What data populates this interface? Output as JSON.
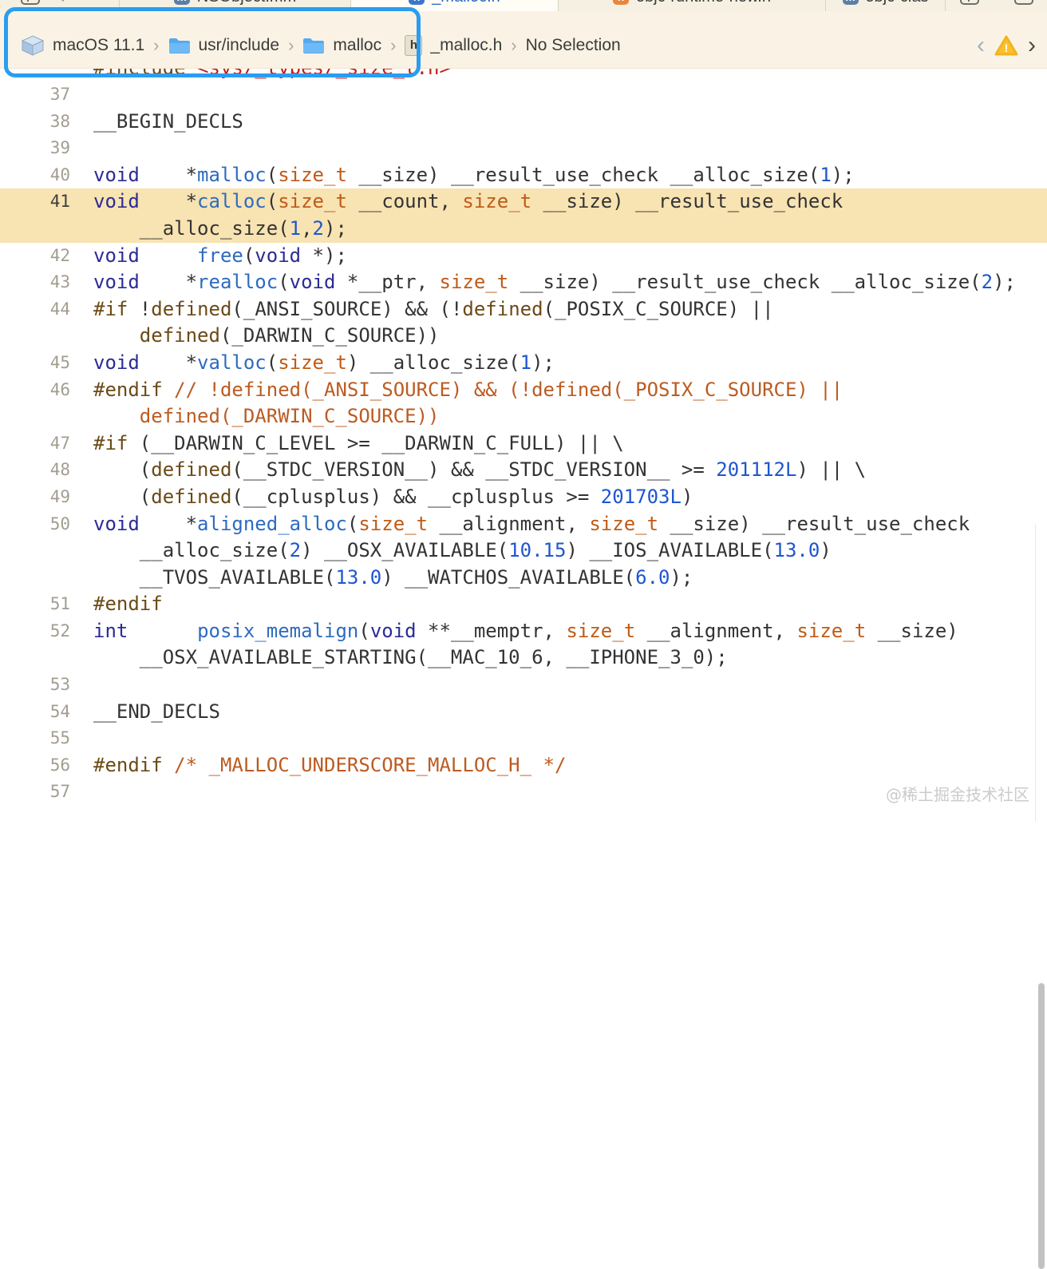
{
  "colors": {
    "keyword": "#2B2B96",
    "function": "#2D6BC0",
    "number": "#1E56CF",
    "type": "#BF5B17",
    "preproc": "#6B4A16",
    "comment": "#BC5B21",
    "string": "#C41A16",
    "plain": "#333333",
    "highlight_line": "#F8E3B2",
    "annotation": "#2B9DF1",
    "jumpbar_bg": "#FAF3E5",
    "active_tab_text": "#2568C6",
    "warning_yellow": "#FBC12C"
  },
  "tabbar": {
    "tabs": [
      {
        "label": "NSObject.mm",
        "icon": "m",
        "icon_color": "#5B7FA6",
        "active": false
      },
      {
        "label": "_malloc.h",
        "icon": "h",
        "icon_color": "#3C78C8",
        "active": true
      },
      {
        "label": "objc-runtime-new.h",
        "icon": "h",
        "icon_color": "#E8873C",
        "active": false
      },
      {
        "label": "objc-clas",
        "icon": "m",
        "icon_color": "#5B7FA6",
        "active": false
      }
    ]
  },
  "jumpbar": {
    "sdk": "macOS 11.1",
    "folder1": "usr/include",
    "folder2": "malloc",
    "file_icon": "h",
    "file": "_malloc.h",
    "selection": "No Selection",
    "separator": "›",
    "back_chevron": "‹",
    "forward_chevron": "›",
    "warning_mark": "!"
  },
  "code": {
    "partial_top_line": {
      "num": "",
      "segs": [
        [
          "d",
          "#include"
        ],
        [
          "p",
          " "
        ],
        [
          "s",
          "<sys/_types/_size_t.h>"
        ]
      ]
    },
    "rows": [
      {
        "num": "37",
        "segs": []
      },
      {
        "num": "38",
        "segs": [
          [
            "p",
            "__BEGIN_DECLS"
          ]
        ]
      },
      {
        "num": "39",
        "segs": []
      },
      {
        "num": "40",
        "segs": [
          [
            "k",
            "void"
          ],
          [
            "p",
            "    *"
          ],
          [
            "f",
            "malloc"
          ],
          [
            "p",
            "("
          ],
          [
            "t",
            "size_t"
          ],
          [
            "p",
            " __size) __result_use_check __alloc_size("
          ],
          [
            "n",
            "1"
          ],
          [
            "p",
            ");"
          ]
        ]
      },
      {
        "num": "41",
        "hl": true,
        "segs": [
          [
            "k",
            "void"
          ],
          [
            "p",
            "    *"
          ],
          [
            "f",
            "calloc"
          ],
          [
            "p",
            "("
          ],
          [
            "t",
            "size_t"
          ],
          [
            "p",
            " __count, "
          ],
          [
            "t",
            "size_t"
          ],
          [
            "p",
            " __size) __result_use_check"
          ]
        ]
      },
      {
        "hl": true,
        "segs": [
          [
            "p",
            "    __alloc_size("
          ],
          [
            "n",
            "1"
          ],
          [
            "p",
            ","
          ],
          [
            "n",
            "2"
          ],
          [
            "p",
            ");"
          ]
        ]
      },
      {
        "num": "42",
        "segs": [
          [
            "k",
            "void"
          ],
          [
            "p",
            "     "
          ],
          [
            "f",
            "free"
          ],
          [
            "p",
            "("
          ],
          [
            "k",
            "void"
          ],
          [
            "p",
            " *);"
          ]
        ]
      },
      {
        "num": "43",
        "segs": [
          [
            "k",
            "void"
          ],
          [
            "p",
            "    *"
          ],
          [
            "f",
            "realloc"
          ],
          [
            "p",
            "("
          ],
          [
            "k",
            "void"
          ],
          [
            "p",
            " *__ptr, "
          ],
          [
            "t",
            "size_t"
          ],
          [
            "p",
            " __size) __result_use_check __alloc_size("
          ],
          [
            "n",
            "2"
          ],
          [
            "p",
            ");"
          ]
        ]
      },
      {
        "num": "44",
        "segs": [
          [
            "d",
            "#if"
          ],
          [
            "p",
            " !"
          ],
          [
            "d",
            "defined"
          ],
          [
            "p",
            "(_ANSI_SOURCE) && (!"
          ],
          [
            "d",
            "defined"
          ],
          [
            "p",
            "(_POSIX_C_SOURCE) ||"
          ]
        ]
      },
      {
        "segs": [
          [
            "p",
            "    "
          ],
          [
            "d",
            "defined"
          ],
          [
            "p",
            "(_DARWIN_C_SOURCE))"
          ]
        ]
      },
      {
        "num": "45",
        "segs": [
          [
            "k",
            "void"
          ],
          [
            "p",
            "    *"
          ],
          [
            "f",
            "valloc"
          ],
          [
            "p",
            "("
          ],
          [
            "t",
            "size_t"
          ],
          [
            "p",
            ") __alloc_size("
          ],
          [
            "n",
            "1"
          ],
          [
            "p",
            ");"
          ]
        ]
      },
      {
        "num": "46",
        "segs": [
          [
            "d",
            "#endif"
          ],
          [
            "c",
            " // !defined(_ANSI_SOURCE) && (!defined(_POSIX_C_SOURCE) ||"
          ]
        ]
      },
      {
        "segs": [
          [
            "c",
            "    defined(_DARWIN_C_SOURCE))"
          ]
        ]
      },
      {
        "num": "47",
        "segs": [
          [
            "d",
            "#if"
          ],
          [
            "p",
            " (__DARWIN_C_LEVEL >= __DARWIN_C_FULL) || \\"
          ]
        ]
      },
      {
        "num": "48",
        "segs": [
          [
            "p",
            "    ("
          ],
          [
            "d",
            "defined"
          ],
          [
            "p",
            "(__STDC_VERSION__) && __STDC_VERSION__ >= "
          ],
          [
            "n",
            "201112L"
          ],
          [
            "p",
            ") || \\"
          ]
        ]
      },
      {
        "num": "49",
        "segs": [
          [
            "p",
            "    ("
          ],
          [
            "d",
            "defined"
          ],
          [
            "p",
            "(__cplusplus) && __cplusplus >= "
          ],
          [
            "n",
            "201703L"
          ],
          [
            "p",
            ")"
          ]
        ]
      },
      {
        "num": "50",
        "segs": [
          [
            "k",
            "void"
          ],
          [
            "p",
            "    *"
          ],
          [
            "f",
            "aligned_alloc"
          ],
          [
            "p",
            "("
          ],
          [
            "t",
            "size_t"
          ],
          [
            "p",
            " __alignment, "
          ],
          [
            "t",
            "size_t"
          ],
          [
            "p",
            " __size) __result_use_check"
          ]
        ]
      },
      {
        "segs": [
          [
            "p",
            "    __alloc_size("
          ],
          [
            "n",
            "2"
          ],
          [
            "p",
            ") __OSX_AVAILABLE("
          ],
          [
            "n",
            "10.15"
          ],
          [
            "p",
            ") __IOS_AVAILABLE("
          ],
          [
            "n",
            "13.0"
          ],
          [
            "p",
            ")"
          ]
        ]
      },
      {
        "segs": [
          [
            "p",
            "    __TVOS_AVAILABLE("
          ],
          [
            "n",
            "13.0"
          ],
          [
            "p",
            ") __WATCHOS_AVAILABLE("
          ],
          [
            "n",
            "6.0"
          ],
          [
            "p",
            ");"
          ]
        ]
      },
      {
        "num": "51",
        "segs": [
          [
            "d",
            "#endif"
          ]
        ]
      },
      {
        "num": "52",
        "segs": [
          [
            "k",
            "int"
          ],
          [
            "p",
            "      "
          ],
          [
            "f",
            "posix_memalign"
          ],
          [
            "p",
            "("
          ],
          [
            "k",
            "void"
          ],
          [
            "p",
            " **__memptr, "
          ],
          [
            "t",
            "size_t"
          ],
          [
            "p",
            " __alignment, "
          ],
          [
            "t",
            "size_t"
          ],
          [
            "p",
            " __size)"
          ]
        ]
      },
      {
        "segs": [
          [
            "p",
            "    __OSX_AVAILABLE_STARTING(__MAC_10_6, __IPHONE_3_0);"
          ]
        ]
      },
      {
        "num": "53",
        "segs": []
      },
      {
        "num": "54",
        "segs": [
          [
            "p",
            "__END_DECLS"
          ]
        ]
      },
      {
        "num": "55",
        "segs": []
      },
      {
        "num": "56",
        "segs": [
          [
            "d",
            "#endif"
          ],
          [
            "c",
            " /* _MALLOC_UNDERSCORE_MALLOC_H_ */"
          ]
        ]
      },
      {
        "num": "57",
        "segs": []
      }
    ]
  },
  "watermark": "@稀土掘金技术社区"
}
